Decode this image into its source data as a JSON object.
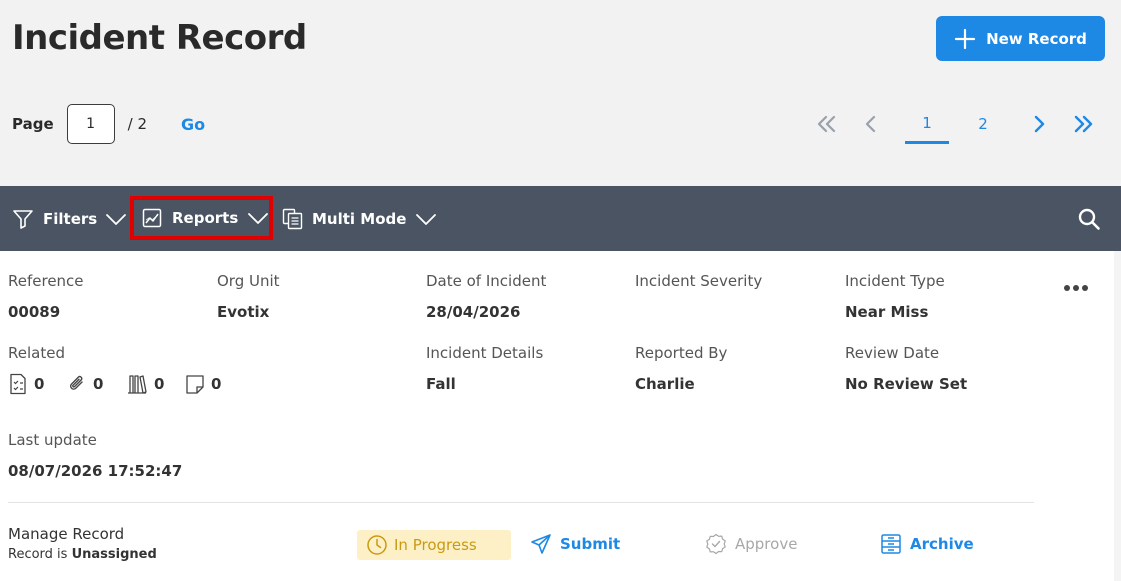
{
  "header": {
    "title": "Incident Record",
    "new_record_label": "New Record"
  },
  "pagination": {
    "page_label": "Page",
    "current_page_value": "1",
    "total_label": "/ 2",
    "go_label": "Go",
    "pages": [
      "1",
      "2"
    ],
    "active_page": "1"
  },
  "toolbar": {
    "filters_label": "Filters",
    "reports_label": "Reports",
    "multi_mode_label": "Multi Mode"
  },
  "record": {
    "fields": {
      "reference_label": "Reference",
      "reference_value": "00089",
      "org_unit_label": "Org Unit",
      "org_unit_value": "Evotix",
      "date_label": "Date of Incident",
      "date_value": "28/04/2026",
      "severity_label": "Incident Severity",
      "severity_value": "",
      "type_label": "Incident Type",
      "type_value": "Near Miss",
      "related_label": "Related",
      "details_label": "Incident Details",
      "details_value": "Fall",
      "reported_label": "Reported By",
      "reported_value": "Charlie",
      "review_label": "Review Date",
      "review_value": "No Review Set",
      "last_update_label": "Last update",
      "last_update_value": "08/07/2026 17:52:47"
    },
    "related": {
      "checklists": "0",
      "attachments": "0",
      "library": "0",
      "notes": "0"
    }
  },
  "manage": {
    "title": "Manage Record",
    "sub_prefix": "Record is",
    "assignment": "Unassigned",
    "status": "In Progress",
    "submit_label": "Submit",
    "approve_label": "Approve",
    "archive_label": "Archive"
  },
  "colors": {
    "accent": "#1e88e5",
    "toolbar_bg": "#4a5462",
    "highlight_border": "#e00000",
    "status_bg": "#fdf0c6",
    "status_text": "#c99a10"
  }
}
